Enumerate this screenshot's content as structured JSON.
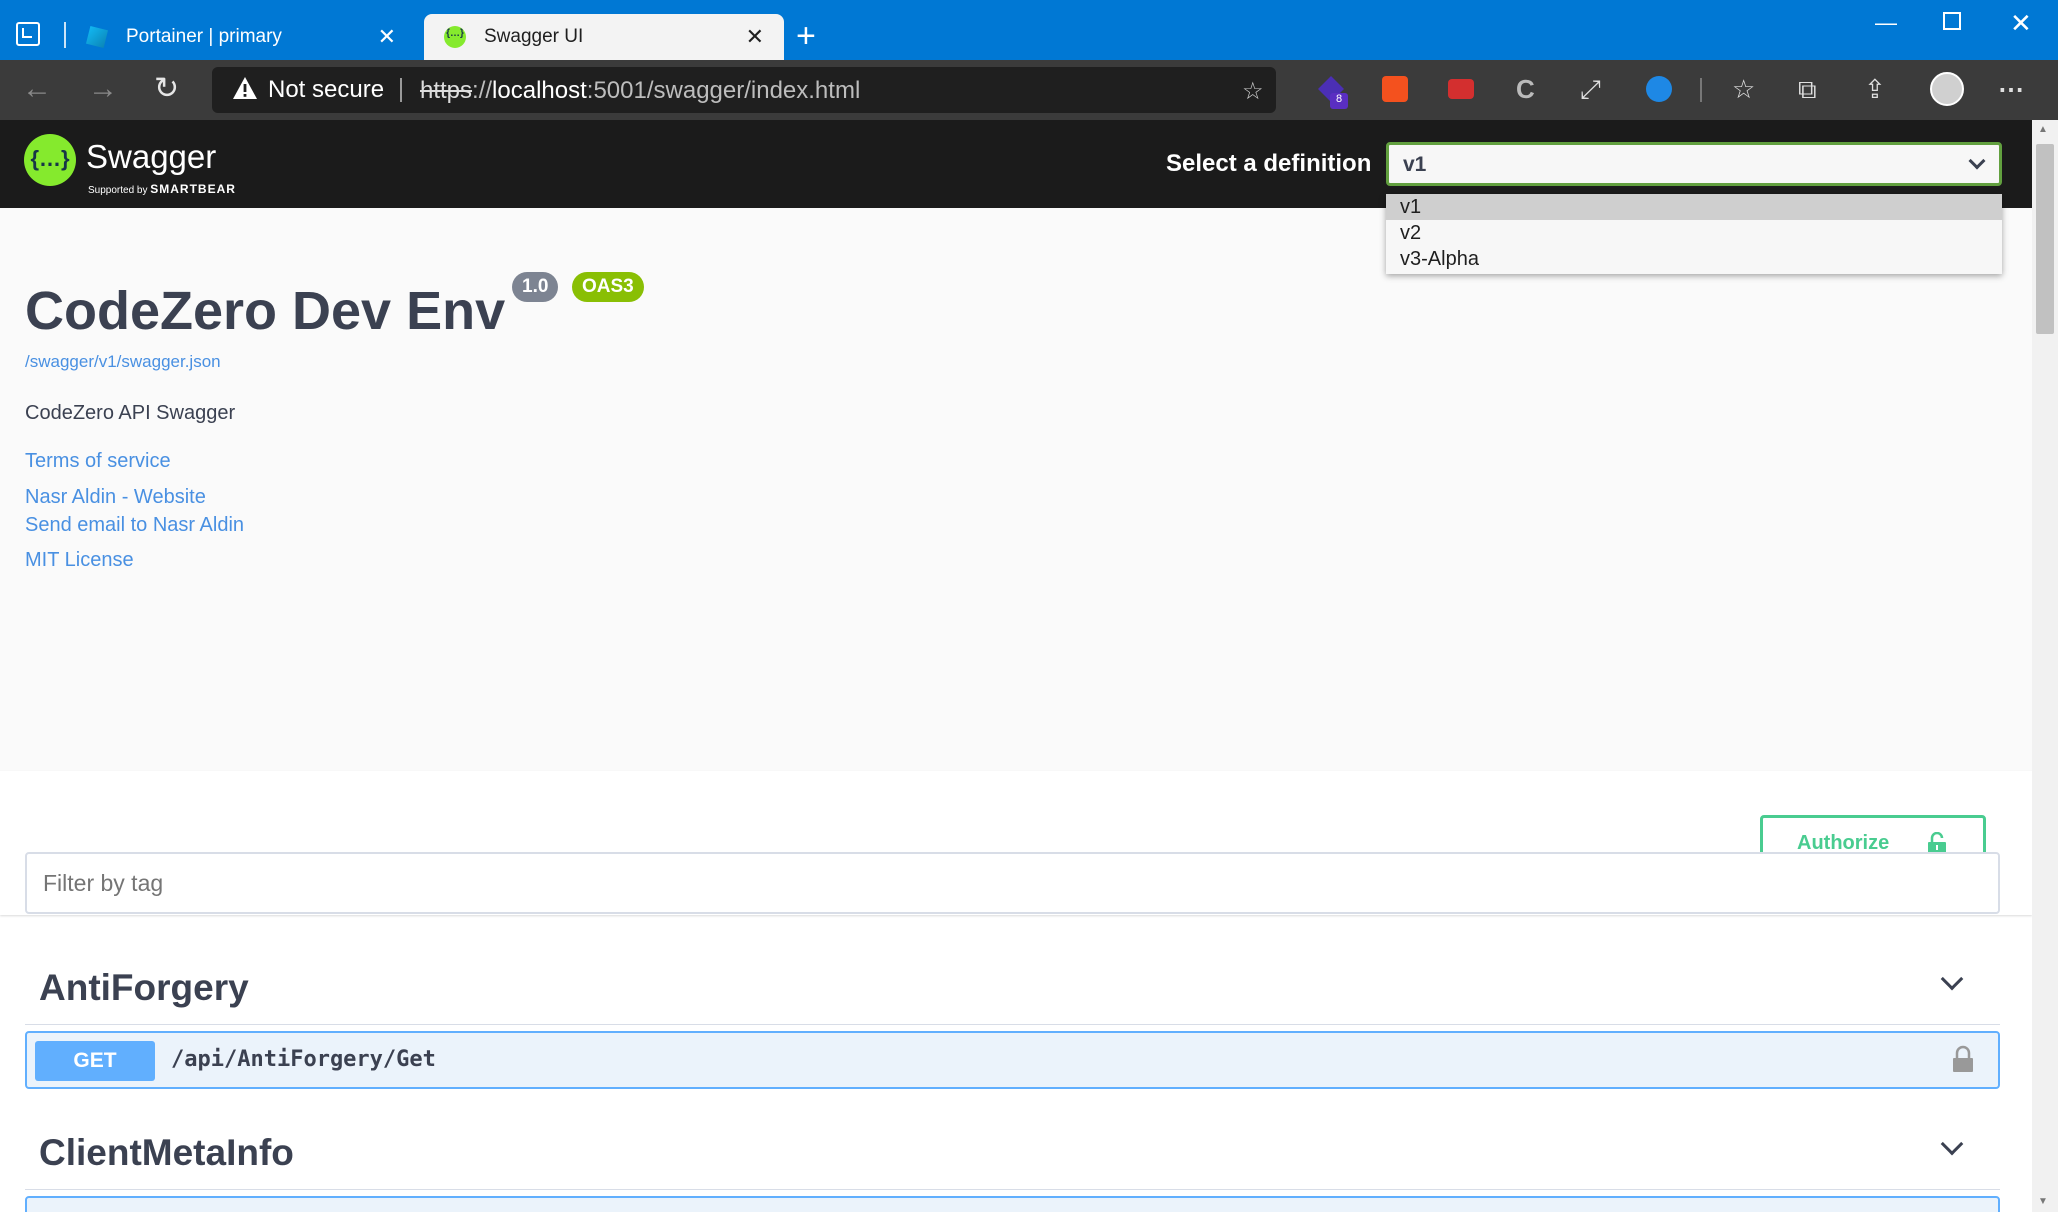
{
  "browser": {
    "tabs": [
      {
        "title": "Portainer | primary",
        "active": false
      },
      {
        "title": "Swagger UI",
        "active": true
      }
    ],
    "security_label": "Not secure",
    "url": {
      "scheme": "https",
      "sep": "://",
      "host": "localhost",
      "rest": ":5001/swagger/index.html"
    },
    "extension_badge": "8"
  },
  "swagger": {
    "logo_name": "Swagger",
    "logo_sub_prefix": "Supported by ",
    "logo_sub_brand": "SMARTBEAR",
    "definition_label": "Select a definition",
    "definition_selected": "v1",
    "definition_options": [
      "v1",
      "v2",
      "v3-Alpha"
    ]
  },
  "info": {
    "title": "CodeZero Dev Env",
    "version": "1.0",
    "oas": "OAS3",
    "spec_url": "/swagger/v1/swagger.json",
    "description": "CodeZero API Swagger",
    "terms": "Terms of service",
    "website": "Nasr Aldin - Website",
    "email": "Send email to Nasr Aldin",
    "license": "MIT License"
  },
  "authorize_label": "Authorize",
  "filter_placeholder": "Filter by tag",
  "tags": [
    {
      "name": "AntiForgery",
      "ops": [
        {
          "method": "GET",
          "path": "/api/AntiForgery/Get"
        }
      ]
    },
    {
      "name": "ClientMetaInfo",
      "ops": []
    }
  ],
  "colors": {
    "get": "#61affe",
    "authorize": "#49cc90",
    "swagger_green": "#85ea2d",
    "oas": "#89bf04"
  }
}
